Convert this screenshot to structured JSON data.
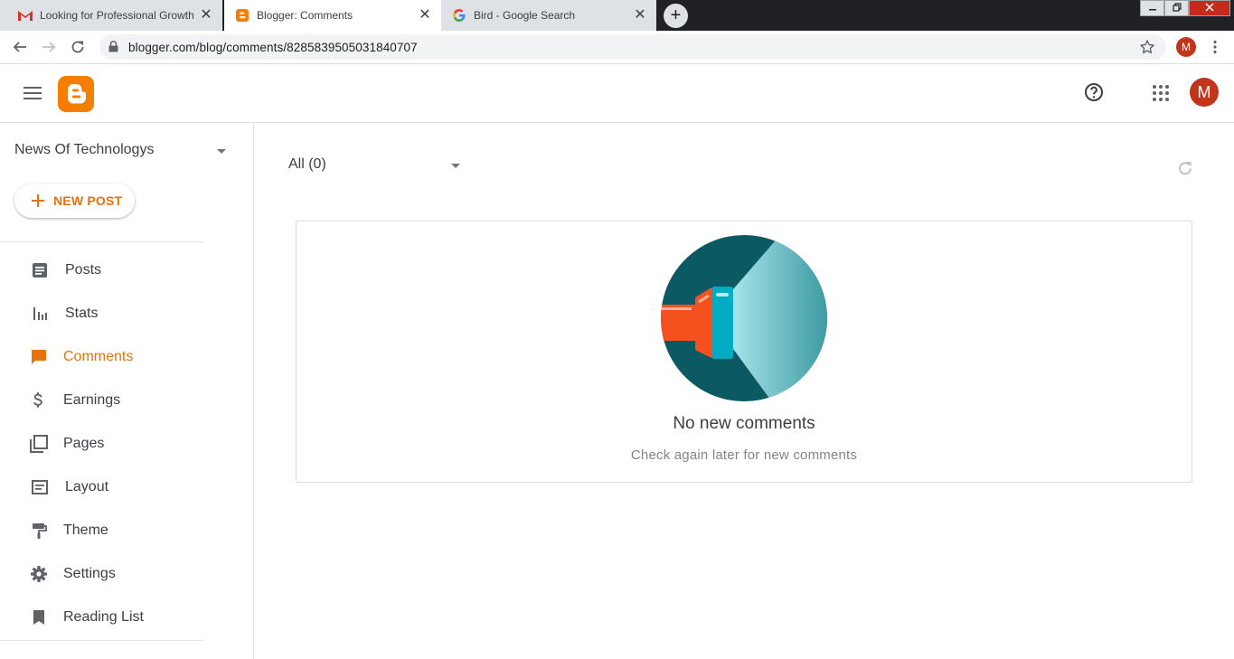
{
  "browser": {
    "tabs": [
      {
        "title": "Looking for Professional Growth?",
        "favicon": "gmail-icon",
        "active": false
      },
      {
        "title": "Blogger: Comments",
        "favicon": "blogger-icon",
        "active": true
      },
      {
        "title": "Bird - Google Search",
        "favicon": "google-icon",
        "active": false
      }
    ],
    "close_glyph": "✕",
    "new_tab_glyph": "+",
    "url": "blogger.com/blog/comments/8285839505031840707",
    "profile_initial": "M"
  },
  "header": {
    "avatar_initial": "M"
  },
  "sidebar": {
    "blog_name": "News Of Technologys",
    "new_post_label": "NEW POST",
    "items": [
      {
        "label": "Posts",
        "icon": "posts-icon"
      },
      {
        "label": "Stats",
        "icon": "stats-icon"
      },
      {
        "label": "Comments",
        "icon": "comments-icon",
        "active": true
      },
      {
        "label": "Earnings",
        "icon": "earnings-icon"
      },
      {
        "label": "Pages",
        "icon": "pages-icon"
      },
      {
        "label": "Layout",
        "icon": "layout-icon"
      },
      {
        "label": "Theme",
        "icon": "theme-icon"
      },
      {
        "label": "Settings",
        "icon": "settings-icon"
      },
      {
        "label": "Reading List",
        "icon": "reading-list-icon"
      }
    ]
  },
  "main": {
    "filter_label": "All (0)",
    "empty_title": "No new comments",
    "empty_subtitle": "Check again later for new comments"
  },
  "colors": {
    "accent": "#e8710a",
    "blogger_orange": "#f57d00",
    "avatar": "#c1351a"
  }
}
